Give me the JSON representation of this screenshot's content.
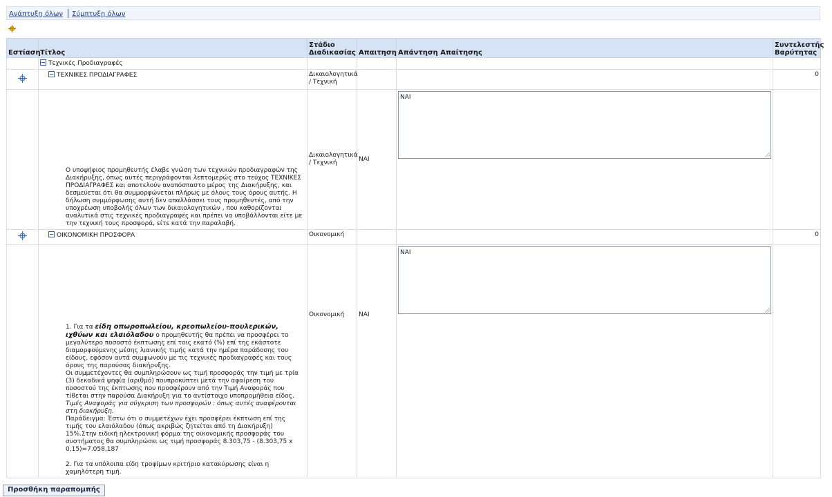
{
  "toolbar": {
    "expand_all": "Ανάπτυξη όλων",
    "collapse_all": "Σύμπτυξη όλων"
  },
  "table": {
    "headers": {
      "focus": "Εστίαση",
      "title": "Τίτλος",
      "stage": "Στάδιο Διαδικασίας",
      "requirement": "Απαιτηση",
      "response": "Απάντηση Απαίτησης",
      "weight": "Συντελεστής Βαρύτητας"
    },
    "group": {
      "label": "Τεχνικές Προδιαγραφές"
    },
    "section1": {
      "title": "ΤΕΧΝΙΚΕΣ ΠΡΟΔΙΑΓΡΑΦΕΣ",
      "stage": "Δικαιολογητικά / Τεχνική",
      "weight": "0"
    },
    "item1": {
      "description": "Ο υποψήφιος προμηθευτής έλαβε γνώση των τεχνικών προδιαγραφών της Διακήρυξης, όπως αυτές περιγράφονται λεπτομερώς στο τεύχος ΤΕΧΝΙΚΕΣ ΠΡΟΔΙΑΓΡΑΦΕΣ και αποτελούν αναπόσπαστο μέρος της Διακήρυξης, και δεσμεύεται ότι θα συμμορφώνεται πλήρως με όλους τους όρους αυτής. Η δήλωση συμμόρφωσης αυτή δεν απαλλάσσει τους προμηθευτές, από την υποχρέωση υποβολής όλων των δικαιολογητικών , που καθορίζονται αναλυτικά στις τεχνικές προδιαγραφές και πρέπει να υποβάλλονται είτε με την τεχνική τους προσφορά, είτε κατά την παραλαβή.",
      "stage": "Δικαιολογητικά / Τεχνική",
      "requirement": "ΝΑΙ",
      "response": "ΝΑΙ"
    },
    "section2": {
      "title": "ΟΙΚΟΝΟΜΙΚΗ ΠΡΟΣΦΟΡΑ",
      "stage": "Οικονομική",
      "weight": "0"
    },
    "item2": {
      "p1_prefix": "1. Για τα ",
      "p1_bold": "είδη οπωροπωλείου, κρεοπωλείου-πουλερικών, ιχθύων και ελαιόλαδου",
      "p1_rest": " ο προμηθευτής θα πρέπει να προσφέρει το μεγαλύτερο ποσοστό έκπτωσης επί τοις εκατό (%) επί της εκάστοτε διαμορφούμενης μέσης λιανικής τιμής κατά την ημέρα παράδοσης του είδους, εφόσον αυτά συμφωνούν με τις τεχνικές προδιαγραφές και τους όρους της παρούσας διακήρυξης.",
      "p2": "Οι συμμετέχοντες θα συμπληρώσουν ως τιμή προσφοράς την τιμή με τρία (3) δεκαδικά ψηφία (αριθμό) πουπροκύπτει μετά την αφαίρεση του ποσοστού της έκπτωσης που προσφέρουν από την Τιμή Αναφοράς που τίθεται στην παρούσα Διακήρυξη για το αντίστοιχο υποπρομήθεια είδος.",
      "p3_italic": "Τιμές Αναφοράς για σύγκριση των προσφορών : όπως αυτές αναφέρονται στη διακήρυξη.",
      "p4": "Παράδειγμα: Έστω ότι ο συμμετέχων έχει προσφέρει έκπτωση επί της τιμής του ελαιόλαδου (όπως ακριβώς ζητείται από τη Διακήρυξη) 15%.Στην ειδική ηλεκτρονική φόρμα της οικονομικής προσφοράς του συστήματος θα συμπληρώσει ως τιμή προσφοράς 8.303,75 - (8.303,75 x 0,15)=7.058,187",
      "p5": "2. Για τα υπόλοιπα είδη τροφίμων κριτήριο κατακύρωσης είναι η χαμηλότερη τιμή.",
      "stage": "Οικονομική",
      "requirement": "ΝΑΙ",
      "response": "ΝΑΙ"
    }
  },
  "add_note_button": "Προσθήκη παραπομπής",
  "colors": {
    "header_bg": "#d6e3f4",
    "link": "#1f3f8a",
    "focus_icon": "#3a6fb5"
  }
}
